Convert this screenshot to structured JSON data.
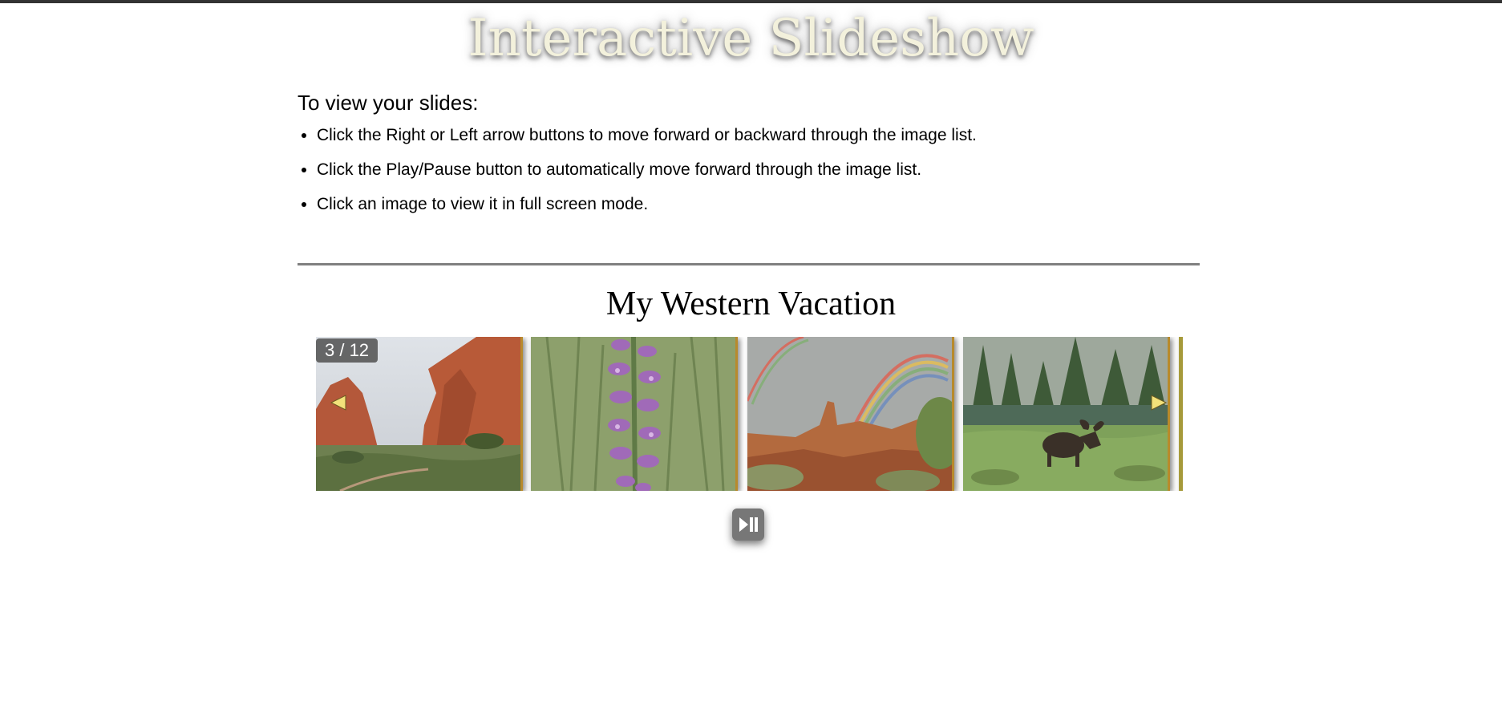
{
  "header": {
    "title": "Interactive Slideshow"
  },
  "instructions": {
    "heading": "To view your slides:",
    "items": [
      "Click the Right or Left arrow buttons to move forward or backward through the image list.",
      "Click the Play/Pause button to automatically move forward through the image list.",
      "Click an image to view it in full screen mode."
    ]
  },
  "gallery": {
    "title": "My Western Vacation",
    "counter": "3 / 12",
    "slides": [
      {
        "subject": "red rock formations"
      },
      {
        "subject": "purple wildflower spike"
      },
      {
        "subject": "double rainbow over canyon"
      },
      {
        "subject": "moose in meadow"
      },
      {
        "subject": "partial next slide"
      }
    ],
    "controls": {
      "prev_icon": "left-triangle-arrow-icon",
      "next_icon": "right-triangle-arrow-icon",
      "play_pause_icon": "play-pause-icon"
    }
  },
  "colors": {
    "title_text": "#f3f1dc",
    "arrow_fill": "#f2e27a",
    "slide_border": "#b88a2c",
    "divider": "#808080",
    "counter_bg": "#505050",
    "button_bg": "#777777"
  }
}
